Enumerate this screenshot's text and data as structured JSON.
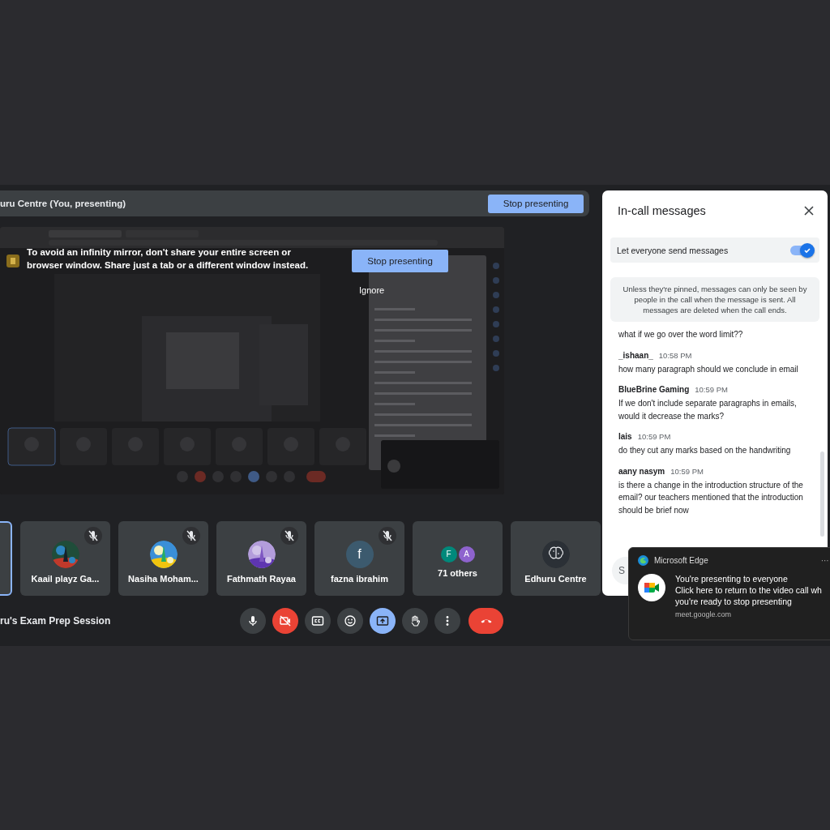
{
  "header": {
    "presenter": "uru Centre (You, presenting)",
    "stop_button": "Stop presenting"
  },
  "shared_screen": {
    "warning": "To avoid an infinity mirror, don't share your entire screen or browser window. Share just a tab or a different window instead.",
    "stop_button": "Stop presenting",
    "ignore_button": "Ignore",
    "kind": "picture"
  },
  "tiles": [
    {
      "selected": true,
      "muted": false,
      "kind": "none"
    },
    {
      "name": "Kaail playz Ga...",
      "selected": false,
      "muted": true,
      "kind": "picture"
    },
    {
      "name": "Nasiha Moham...",
      "selected": false,
      "muted": true,
      "kind": "picture"
    },
    {
      "name": "Fathmath Rayaa",
      "selected": false,
      "muted": true,
      "kind": "picture"
    },
    {
      "name": "fazna ibrahim",
      "selected": false,
      "muted": true,
      "kind": "letter",
      "letter": "f",
      "color": "#3c5a6e"
    },
    {
      "name": "71 others",
      "selected": false,
      "muted": false,
      "kind": "group",
      "letters": [
        {
          "letter": "F",
          "color": "#00897b"
        },
        {
          "letter": "A",
          "color": "#8e63ce"
        }
      ]
    },
    {
      "name": "Edhuru Centre",
      "selected": false,
      "muted": false,
      "kind": "logo"
    }
  ],
  "meeting_title": "ru's Exam Prep Session",
  "controls": [
    {
      "kind": "mic"
    },
    {
      "kind": "camera_off"
    },
    {
      "kind": "captions"
    },
    {
      "kind": "emoji"
    },
    {
      "kind": "present"
    },
    {
      "kind": "hand"
    },
    {
      "kind": "more"
    },
    {
      "kind": "end_call"
    }
  ],
  "chat": {
    "title": "In-call messages",
    "toggle": {
      "label": "Let everyone send messages",
      "on": true
    },
    "notice": "Unless they're pinned, messages can only be seen by people in the call when the message is sent. All messages are deleted when the call ends.",
    "messages": [
      {
        "text": "what if we go over the word limit??"
      },
      {
        "sender": "_ishaan_",
        "time": "10:58 PM",
        "text": "how many paragraph should we conclude in  email"
      },
      {
        "sender": "BlueBrine Gaming",
        "time": "10:59 PM",
        "text": "If we don't include separate paragraphs in emails, would it decrease the marks?"
      },
      {
        "sender": "lais",
        "time": "10:59 PM",
        "text": "do they cut any marks based on the handwriting"
      },
      {
        "sender": "aany nasym",
        "time": "10:59 PM",
        "text": "is there a change in the introduction structure of the email? our teachers mentioned that the introduction should be brief now"
      }
    ],
    "input_placeholder": "S"
  },
  "notification": {
    "app": "Microsoft Edge",
    "more": "···",
    "title": "You're presenting to everyone",
    "body_lines": [
      "Click here to return to the video call wh",
      "you're ready to stop presenting"
    ],
    "source": "meet.google.com"
  }
}
